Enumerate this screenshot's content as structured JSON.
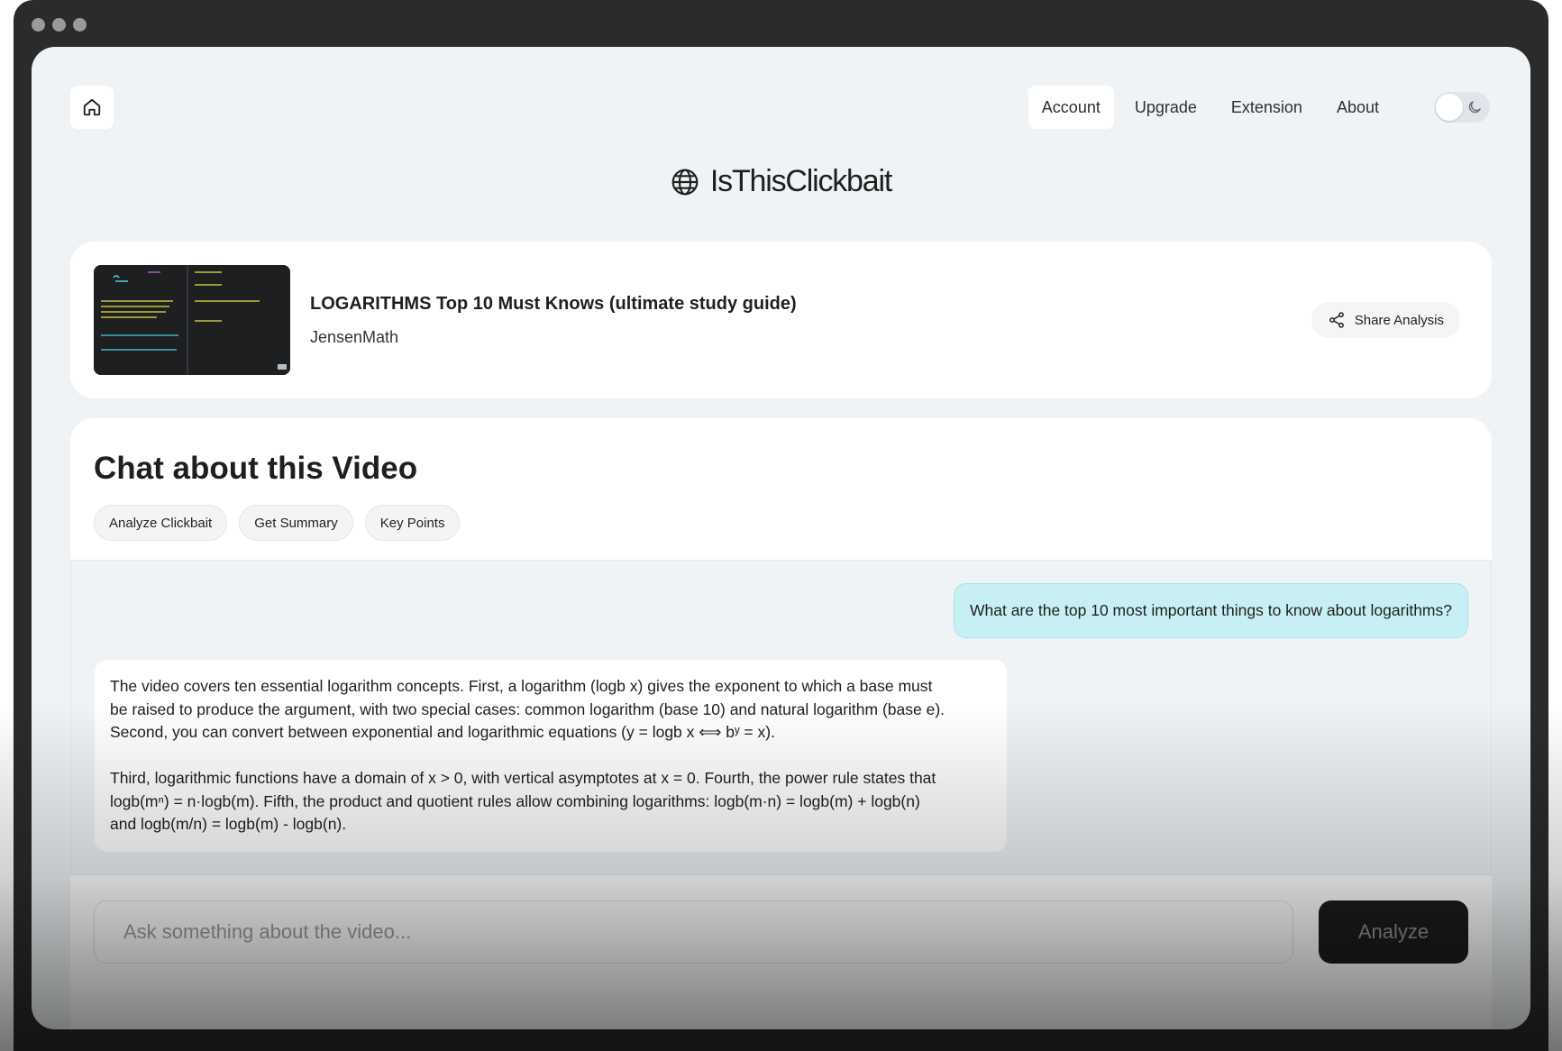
{
  "nav": {
    "home_icon": "home-icon",
    "items": [
      {
        "label": "Account",
        "active": true
      },
      {
        "label": "Upgrade",
        "active": false
      },
      {
        "label": "Extension",
        "active": false
      },
      {
        "label": "About",
        "active": false
      }
    ],
    "theme_toggle_icon": "moon-icon"
  },
  "brand": {
    "icon": "globe-icon",
    "title": "IsThisClickbait"
  },
  "video": {
    "title": "LOGARITHMS Top 10 Must Knows (ultimate study guide)",
    "channel": "JensenMath",
    "share_label": "Share Analysis",
    "share_icon": "share-icon"
  },
  "chat": {
    "heading": "Chat about this Video",
    "chips": [
      "Analyze Clickbait",
      "Get Summary",
      "Key Points"
    ],
    "user_message": "What are the top 10 most important things to know about logarithms?",
    "assistant_paragraphs": [
      "The video covers ten essential logarithm concepts. First, a logarithm (logb x) gives the exponent to which a base must\nbe raised to produce the argument, with two special cases: common logarithm (base 10) and natural logarithm (base e).\nSecond, you can convert between exponential and logarithmic equations (y = logb x ⟺ bʸ = x).",
      "Third, logarithmic functions have a domain of x > 0, with vertical asymptotes at x = 0. Fourth, the power rule states that\nlogb(mⁿ) = n·logb(m). Fifth, the product and quotient rules allow combining logarithms: logb(m·n) = logb(m) + logb(n)\nand logb(m/n) = logb(m) - logb(n)."
    ],
    "input_placeholder": "Ask something about the video...",
    "input_value": "",
    "submit_label": "Analyze"
  },
  "colors": {
    "background": "#eff3f5",
    "card": "#ffffff",
    "user_bubble": "#c8f0f4",
    "button_dark": "#1c1c1c"
  }
}
